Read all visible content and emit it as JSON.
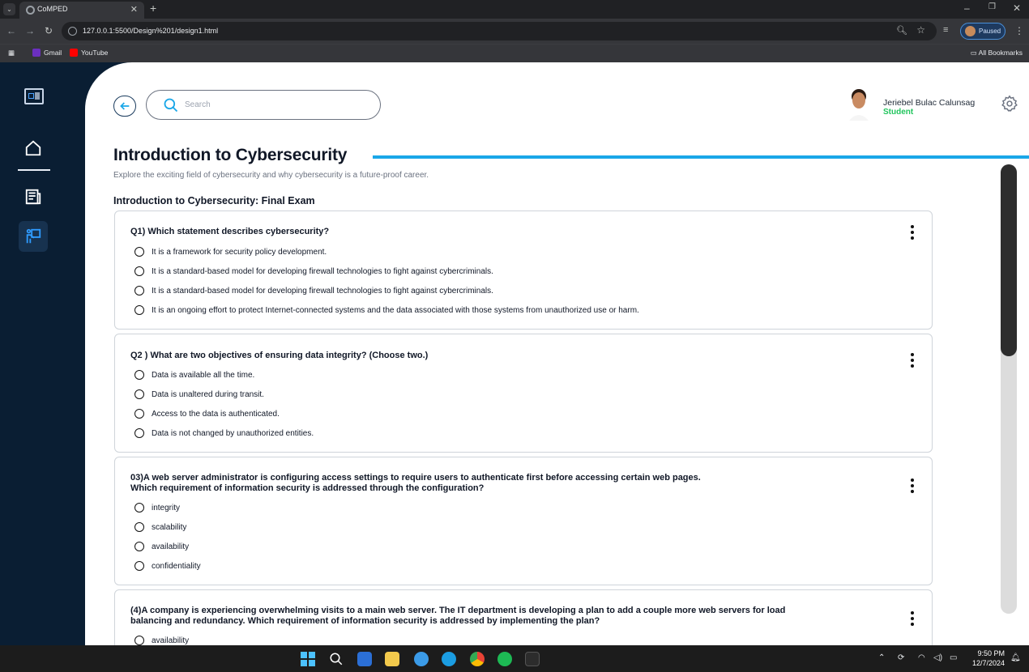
{
  "browser": {
    "tab_title": "CoMPED",
    "url": "127.0.0.1:5500/Design%201/design1.html",
    "profile_status": "Paused",
    "bookmarks": [
      "Gmail",
      "YouTube"
    ],
    "all_bookmarks": "All Bookmarks"
  },
  "header": {
    "search_placeholder": "Search",
    "user_name": "Jeriebel Bulac Calunsag",
    "user_role": "Student"
  },
  "page": {
    "title": "Introduction to Cybersecurity",
    "subtitle": "Explore the exciting field of cybersecurity and why cybersecurity is a future-proof career.",
    "exam_title": "Introduction to Cybersecurity: Final Exam"
  },
  "questions": [
    {
      "text": "Q1) Which statement describes cybersecurity?",
      "options": [
        "It is a framework for security policy development.",
        "It is a standard-based model for developing firewall technologies to fight against cybercriminals.",
        "It is a standard-based model for developing firewall technologies to fight against cybercriminals.",
        "It is an ongoing effort to protect Internet-connected systems and the data associated with those systems from unauthorized use or harm."
      ]
    },
    {
      "text": "Q2 ) What are two objectives of ensuring data integrity? (Choose two.)",
      "options": [
        "Data is available all the time.",
        "Data is unaltered during transit.",
        "Access to the data is authenticated.",
        "Data is not changed by unauthorized entities."
      ]
    },
    {
      "text": "03)A web server administrator is configuring access settings to require users to authenticate first before accessing certain web pages.\nWhich requirement of information security is addressed through the configuration?",
      "options": [
        "integrity",
        "scalability",
        "availability",
        "confidentiality"
      ]
    },
    {
      "text": "(4)A company is experiencing overwhelming visits to a main web server. The IT department is developing a plan to add a couple more web servers for load\nbalancing and redundancy. Which requirement of information security is addressed by implementing the plan?",
      "options": [
        "availability"
      ]
    }
  ],
  "taskbar": {
    "time": "9:50 PM",
    "date": "12/7/2024"
  }
}
